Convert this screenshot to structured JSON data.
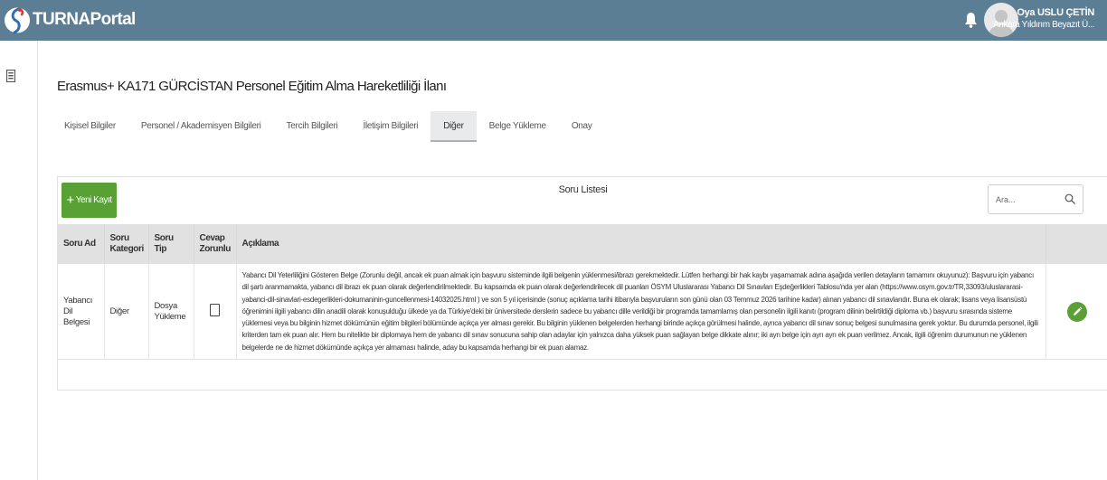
{
  "app": {
    "brand": "TURNAPortal"
  },
  "user": {
    "name": "Oya USLU ÇETİN",
    "org": "Ankara Yıldırım Beyazıt Ü..."
  },
  "page": {
    "title": "Erasmus+ KA171 GÜRCİSTAN Personel Eğitim Alma Hareketliliği İlanı"
  },
  "tabs": [
    {
      "label": "Kişisel Bilgiler",
      "active": false
    },
    {
      "label": "Personel / Akademisyen Bilgileri",
      "active": false
    },
    {
      "label": "Tercih Bilgileri",
      "active": false
    },
    {
      "label": "İletişim Bilgileri",
      "active": false
    },
    {
      "label": "Diğer",
      "active": true
    },
    {
      "label": "Belge Yükleme",
      "active": false
    },
    {
      "label": "Onay",
      "active": false
    }
  ],
  "list": {
    "title": "Soru Listesi",
    "add_label": "Yeni Kayıt",
    "search_placeholder": "Ara...",
    "columns": [
      "Soru Ad",
      "Soru Kategori",
      "Soru Tip",
      "Cevap Zorunlu",
      "Açıklama"
    ],
    "rows": [
      {
        "name": "Yabancı Dil Belgesi",
        "category": "Diğer",
        "type": "Dosya Yükleme",
        "required": false,
        "description": "Yabancı Dil Yeterliliğini Gösteren Belge (Zorunlu değil, ancak ek puan almak için başvuru sisteminde ilgili belgenin yüklenmesi/ibrazı gerekmektedir. Lütfen herhangi bir hak kaybı yaşamamak adına aşağıda verilen detayların tamamını okuyunuz): Başvuru için yabancı dil şartı aranmamakta, yabancı dil ibrazı ek puan olarak değerlendirilmektedir. Bu kapsamda ek puan olarak değerlendirilecek dil puanları ÖSYM Uluslararası Yabancı Dil Sınavları Eşdeğerlikleri Tablosu'nda yer alan (https://www.osym.gov.tr/TR,33093/uluslararasi-yabanci-dil-sinavlari-esdegerlikleri-dokumaninin-guncellenmesi-14032025.html ) ve son 5 yıl içerisinde (sonuç açıklama tarihi itibarıyla başvuruların son günü olan 03 Temmuz 2026 tarihine kadar) alınan yabancı dil sınavlarıdır. Buna ek olarak; lisans veya lisansüstü öğrenimini ilgili yabancı dilin anadili olarak konuşulduğu ülkede ya da Türkiye'deki bir üniversitede derslerin sadece bu yabancı dille verildiği bir programda tamamlamış olan personelin ilgili kanıtı (program dilinin belirtildiği diploma vb.) başvuru sırasında sisteme yüklemesi veya bu bilginin hizmet dökümünün eğitim bilgileri bölümünde açıkça yer alması gerekir. Bu bilginin yüklenen belgelerden herhangi birinde açıkça görülmesi halinde, ayrıca yabancı dil sınav sonuç belgesi sunulmasına gerek yoktur. Bu durumda personel, ilgili kriterden tam ek puan alır. Hem bu nitelikte bir diplomaya hem de yabancı dil sınav sonucuna sahip olan adaylar için yalnızca daha yüksek puan sağlayan belge dikkate alınır; iki ayrı belge için ayrı ayrı ek puan verilmez. Ancak, ilgili öğrenim durumunun ne yüklenen belgelerde ne de hizmet dökümünde açıkça yer almaması halinde, aday bu kapsamda herhangi bir ek puan alamaz."
      }
    ]
  },
  "colors": {
    "topbar": "#5c7e94",
    "accent_green": "#59a135",
    "header_gray": "#e1e1e1"
  },
  "icons": {
    "logo": "turna-logo",
    "bell": "bell-icon",
    "avatar": "user-avatar-icon",
    "menu": "document-menu-icon",
    "search": "search-icon",
    "edit": "pencil-icon"
  }
}
